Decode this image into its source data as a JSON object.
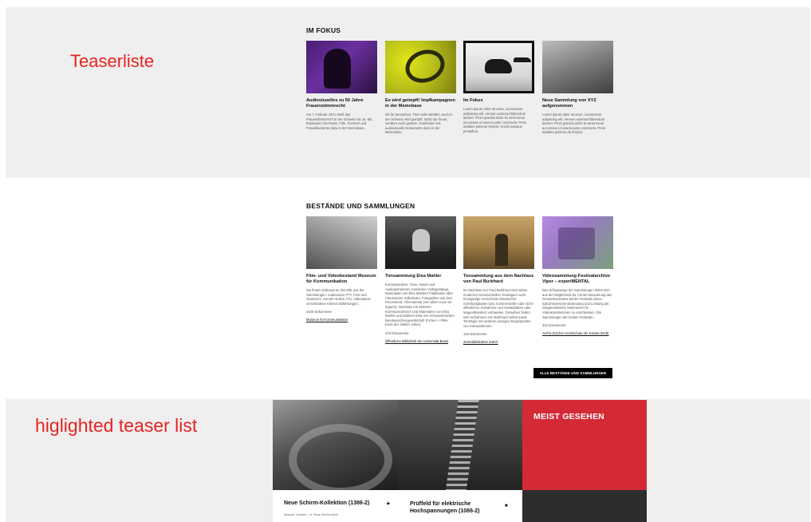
{
  "annotations": {
    "teaserliste": "Teaserliste",
    "highlighted": "higlighted teaser list"
  },
  "fokus": {
    "title": "IM FOKUS",
    "cards": [
      {
        "title": "Audiovisuelles zu 50 Jahre Frauenstimmrecht",
        "text": "Am 7. Februar 1971 stieß das Frauenstimmrecht in der Schweiz ein Ja. Mit. Entdecken Sie Radio, Film, Fernseh und Fotodokumente dazu in der Memobase."
      },
      {
        "title": "Es wird geimpft! Impfkampagnen in der Memobase",
        "text": "Ob für Menschen, Tiere oder Weiden, auch in der Schweiz wird geimpft. Nicht nur heute, sondern auch gestern. Entdecken Sie audiovisuelle Dokumente dazu in der Memobase."
      },
      {
        "title": "Im Fokus",
        "text": "Lorem ipsum dolor sit amet, consectetur adipiscing elit. Aenean euismod bibendum laoreet. Proin gravida dolor sit amet lacus accumsan et viverra justo commodo. Proin sodales pulvinar tempor. Sociis natoque penatibus."
      },
      {
        "title": "Neue Sammlung von XYZ aufgenommen",
        "text": "Lorem ipsum dolor sit amet, consectetur adipiscing elit. Aenean euismod bibendum laoreet. Proin gravida dolor sit amet lacus accumsan et viverra justo commodo. Proin sodales pulvinar do tempor."
      }
    ]
  },
  "bestaende": {
    "title": "BESTÄNDE UND SAMMLUNGEN",
    "cards": [
      {
        "title": "Film- und Videobestand Museum für Kommunikation",
        "text": "Sie finden Dokumente des MfK aus der Sammlungen. Audiovision PTT, Post und Swisscom. Aeromi Herbst, ITU, Videokanal, verschiedene Kleines Abführungen…",
        "count": "2445 Dokumente",
        "link": "Museum für Kommunikation"
      },
      {
        "title": "Tonsammlung Elsa Mahler",
        "text": "Korrespondenz, Texte, Noten und Audioaufnahmen russischer Volksgesänge, Materialien von Elsa Mahlers Publikation über Altrussische Volkslieder, Fotografien aus dem Pecorstand, Filmmaterial (von allem rund um Zypern), Nachlass mit weiteren Korrespondenzen und Materialien von Elsa Mahler und Mahlers Erbe der Schweizerischen Bundesarchivsgesellschaft (Fichen + Pilke Ende der 1960er Jahre).",
        "count": "203 Dokumente",
        "link": "Öffentliche Bibliothek der Universität Basel"
      },
      {
        "title": "Tonsammlung aus dem Nachlass von Paul Burkhard",
        "text": "Im Nachlass von Paul Burkhard sind neben modernen kommerziellen Tonträgern auch einzigartige Ausschnitte historischer Schellackplatten bzw. kommerzieller oder nicht-öffentlicher Aufnahmen auf Azetatplatten oder Magnetbändern vorhanden. Dieselben finden sich Aufnahmen von Burkhard selbst sowie Tonträger mit weiteren einzigen Eingespielten von Kompositionen.",
        "count": "133 Dokumente",
        "link": "Zentralbibliothek Zürich"
      },
      {
        "title": "Videosammlung Festivalarchive Viper – experiMENTAL",
        "text": "Das Erfolgswege der Sammlungen liefert sich aus der Möglichkeit da, mit der Bewahrung des Gesamtkontextes beider Festivals deren kulturhistorische Bedeutung und Leistung als zeitgenössische Seiteneiner für Videokünstlerinnen zu erschliessen. Die Sammlungen der beiden Festivals…",
        "count": "302 Dokumente",
        "link": "Archiv Zürcher Hochschule der Künste ZHdK"
      }
    ],
    "button": "ALLE BESTÄNDE UND SAMMLUNGEN"
  },
  "highlight": {
    "red_title": "MEIST GESEHEN",
    "item1_title": "Neue Schirm-Kollektion (1386-2)",
    "item1_text": "Abstract: Schwed. = A: Neue Schirm-Mode",
    "item2_title": "Prüffeld für elektrische Hochspannungen (1086-2)",
    "lock_icon": "lock-icon"
  }
}
